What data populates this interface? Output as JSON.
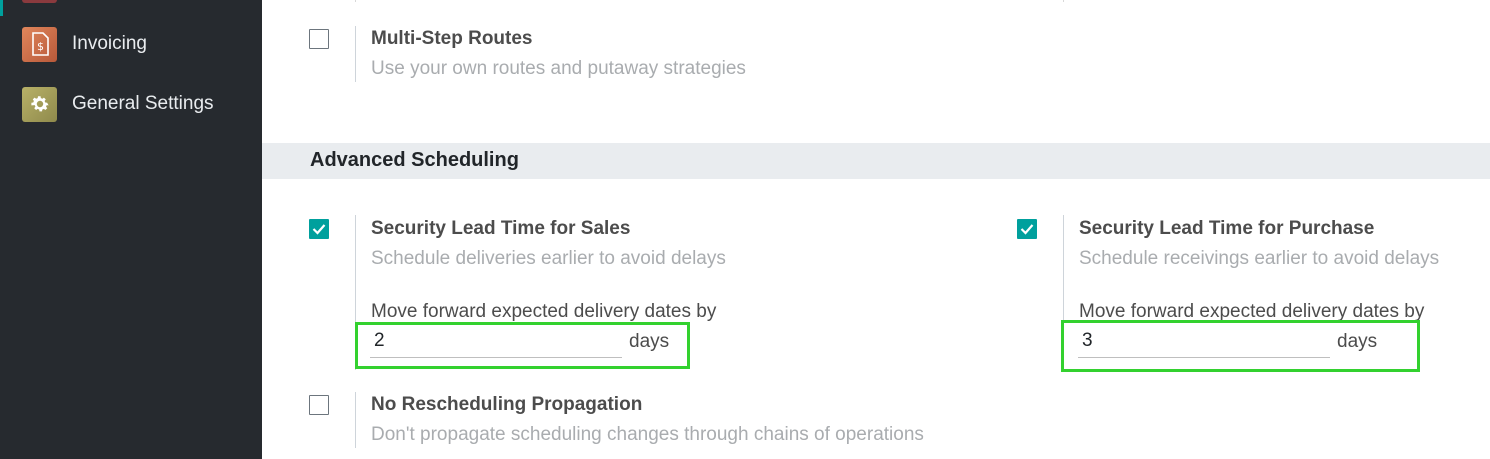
{
  "sidebar": {
    "items": [
      {
        "label": "Invoicing",
        "icon": "invoice-dollar-icon"
      },
      {
        "label": "General Settings",
        "icon": "gear-icon"
      }
    ]
  },
  "settings": {
    "multi_step_routes": {
      "title": "Multi-Step Routes",
      "description": "Use your own routes and putaway strategies",
      "checked": false
    },
    "advanced_scheduling": {
      "section_title": "Advanced Scheduling",
      "security_lead_sales": {
        "title": "Security Lead Time for Sales",
        "description": "Schedule deliveries earlier to avoid delays",
        "field_label": "Move forward expected delivery dates by",
        "value": "2",
        "unit": "days",
        "checked": true
      },
      "security_lead_purchase": {
        "title": "Security Lead Time for Purchase",
        "description": "Schedule receivings earlier to avoid delays",
        "field_label": "Move forward expected delivery dates by",
        "value": "3",
        "unit": "days",
        "checked": true
      },
      "no_rescheduling": {
        "title": "No Rescheduling Propagation",
        "description": "Don't propagate scheduling changes through chains of operations",
        "checked": false
      }
    }
  },
  "colors": {
    "accent": "#00a09d",
    "highlight": "#33d12f",
    "sidebar_bg": "#262a2f"
  }
}
